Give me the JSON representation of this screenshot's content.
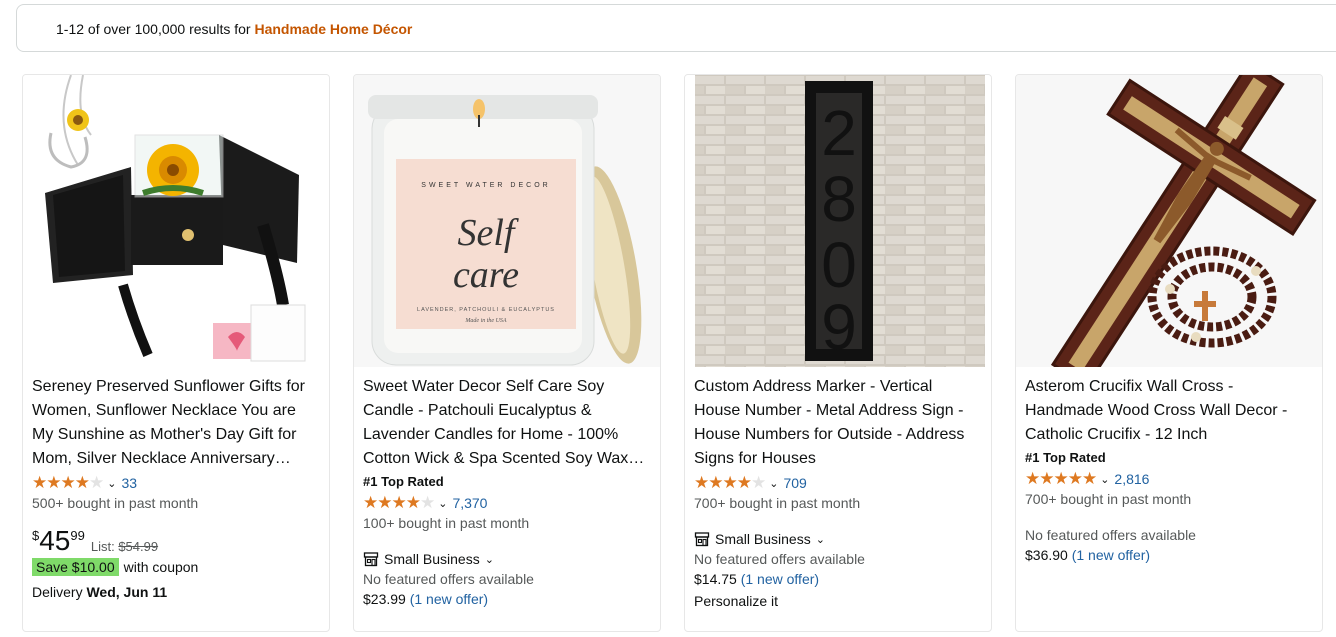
{
  "search": {
    "summary_prefix": "1-12 of over 100,000 results for ",
    "query": "Handmade Home Décor"
  },
  "products": [
    {
      "title": "Sereney Preserved Sunflower Gifts for Women, Sunflower Necklace You are My Sunshine as Mother's Day Gift for Mom, Silver Necklace Anniversary Birthday Gifts",
      "rating": 4.5,
      "rating_count": "33",
      "bought": "500+ bought in past month",
      "price_symbol": "$",
      "price_whole": "45",
      "price_fraction": "99",
      "list_label": "List:",
      "list_price": "$54.99",
      "coupon_label": "Save $10.00",
      "coupon_text": "with coupon",
      "delivery_label": "Delivery",
      "delivery_date": "Wed, Jun 11"
    },
    {
      "title": "Sweet Water Decor Self Care Soy Candle - Patchouli Eucalyptus & Lavender Candles for Home - 100% Cotton Wick & Spa Scented Soy Wax Candle",
      "badge": "#1 Top Rated",
      "rating": 4.5,
      "rating_count": "7,370",
      "bought": "100+ bought in past month",
      "small_business": "Small Business",
      "no_offers": "No featured offers available",
      "offer_price": "$23.99",
      "offer_link": "(1 new offer)",
      "image_text": {
        "brand": "SWEET WATER DECOR",
        "name_line1": "Self",
        "name_line2": "care",
        "notes": "LAVENDER, PATCHOULI & EUCALYPTUS",
        "origin": "Made in the USA"
      }
    },
    {
      "title": "Custom Address Marker - Vertical House Number - Metal Address Sign - House Numbers for Outside - Address Signs for Houses",
      "rating": 4.5,
      "rating_count": "709",
      "bought": "700+ bought in past month",
      "small_business": "Small Business",
      "no_offers": "No featured offers available",
      "offer_price": "$14.75",
      "offer_link": "(1 new offer)",
      "personalize": "Personalize it",
      "image_digits": [
        "2",
        "8",
        "0",
        "9"
      ]
    },
    {
      "title": "Asterom Crucifix Wall Cross - Handmade Wood Cross Wall Decor - Catholic Crucifix - 12 Inch",
      "badge": "#1 Top Rated",
      "rating": 5,
      "rating_count": "2,816",
      "bought": "700+ bought in past month",
      "no_offers": "No featured offers available",
      "offer_price": "$36.90",
      "offer_link": "(1 new offer)"
    }
  ],
  "colors": {
    "star": "#de7921",
    "link": "#2162a1",
    "query": "#c45500",
    "coupon": "#7fda69"
  },
  "icons": {
    "star": "star-icon",
    "chevron": "chevron-down-icon",
    "shop": "small-business-icon"
  }
}
